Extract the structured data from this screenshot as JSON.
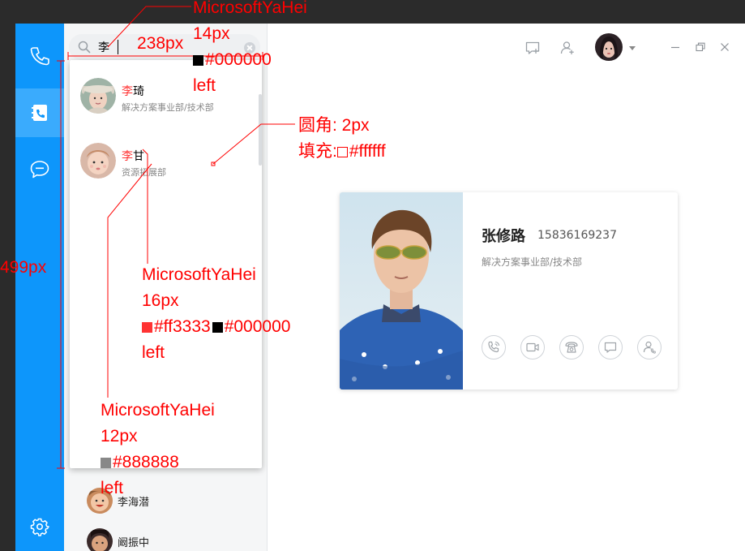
{
  "window": {
    "nav": [
      {
        "icon": "phone-icon"
      },
      {
        "icon": "contacts-book-icon",
        "active": true
      },
      {
        "icon": "chat-bubble-icon"
      }
    ],
    "settings_icon": "gear-icon"
  },
  "search": {
    "value": "李",
    "icon": "search-icon",
    "clear_icon": "clear-icon"
  },
  "results": [
    {
      "name_hl": "李",
      "name_rest": "琦",
      "dept": "解决方案事业部/技术部",
      "avatar": "avatar-girl-hat"
    },
    {
      "name_hl": "李",
      "name_rest": "甘",
      "dept": "资源拓展部",
      "avatar": "avatar-child"
    }
  ],
  "background_list": [
    {
      "name": "李海潜",
      "avatar": "avatar-smiling-child"
    },
    {
      "name": "阚振中",
      "avatar": "avatar-boy"
    }
  ],
  "titlebar": {
    "icons": [
      "message-add-icon",
      "add-user-icon"
    ],
    "window_controls": [
      "minimize-icon",
      "restore-icon",
      "close-icon"
    ]
  },
  "card": {
    "name": "张修路",
    "phone": "15836169237",
    "dept": "解决方案事业部/技术部",
    "actions": [
      "voice-call-icon",
      "video-call-icon",
      "telephone-icon",
      "message-icon",
      "transfer-icon"
    ]
  },
  "annotations": {
    "top_font": "MicrosoftYaHei",
    "top_size": "14px",
    "top_color": "#000000",
    "top_align": "left",
    "width_label": "238px",
    "height_label": "499px",
    "radius_label": "圆角: 2px",
    "fill_label": "填充:",
    "fill_color": "#ffffff",
    "name_font": "MicrosoftYaHei",
    "name_size": "16px",
    "name_color1": "#ff3333",
    "name_color2": "#000000",
    "name_align": "left",
    "dept_font": "MicrosoftYaHei",
    "dept_size": "12px",
    "dept_color": "#888888",
    "dept_align": "left",
    "colors": {
      "highlight": "#ff3333",
      "black": "#000000",
      "gray": "#888888",
      "rail": "#0d96fb",
      "annotation": "#ff0000"
    }
  }
}
